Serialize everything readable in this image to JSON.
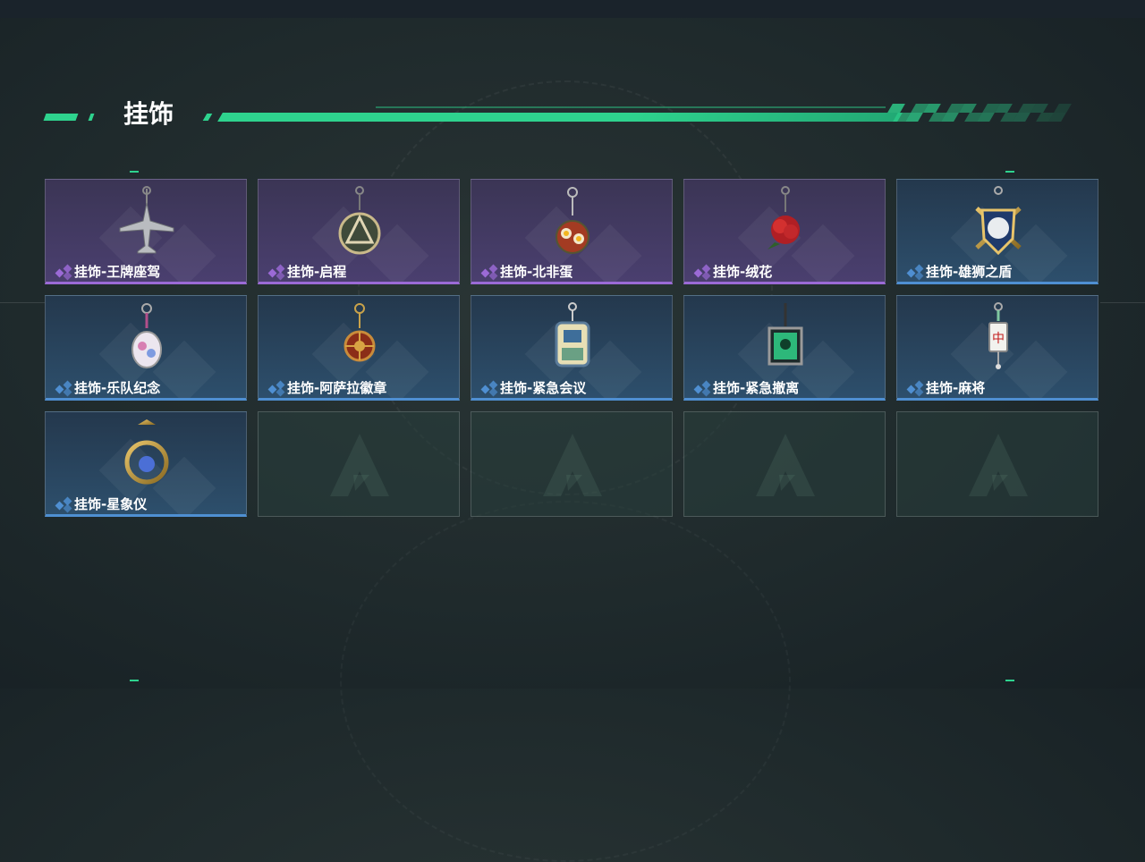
{
  "section": {
    "title": "挂饰"
  },
  "colors": {
    "accent": "#2ed38e",
    "rare_purple": "#9b6ad6",
    "rare_blue": "#4f8fd2"
  },
  "items": [
    {
      "name": "挂饰-王牌座驾",
      "rarity": "purple",
      "icon": "plane-charm-icon"
    },
    {
      "name": "挂饰-启程",
      "rarity": "purple",
      "icon": "medallion-charm-icon"
    },
    {
      "name": "挂饰-北非蛋",
      "rarity": "purple",
      "icon": "shakshuka-charm-icon"
    },
    {
      "name": "挂饰-绒花",
      "rarity": "purple",
      "icon": "red-flower-charm-icon"
    },
    {
      "name": "挂饰-雄狮之盾",
      "rarity": "blue",
      "icon": "lion-shield-charm-icon"
    },
    {
      "name": "挂饰-乐队纪念",
      "rarity": "blue",
      "icon": "band-badge-charm-icon"
    },
    {
      "name": "挂饰-阿萨拉徽章",
      "rarity": "blue",
      "icon": "asala-badge-charm-icon"
    },
    {
      "name": "挂饰-紧急会议",
      "rarity": "blue",
      "icon": "meeting-charm-icon"
    },
    {
      "name": "挂饰-紧急撤离",
      "rarity": "blue",
      "icon": "evacuation-charm-icon"
    },
    {
      "name": "挂饰-麻将",
      "rarity": "blue",
      "icon": "mahjong-charm-icon"
    },
    {
      "name": "挂饰-星象仪",
      "rarity": "blue",
      "icon": "astrolabe-charm-icon"
    }
  ],
  "empty_slots": 4
}
